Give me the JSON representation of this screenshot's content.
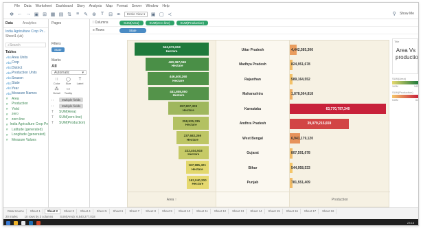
{
  "menu": [
    "File",
    "Data",
    "Worksheet",
    "Dashboard",
    "Story",
    "Analysis",
    "Map",
    "Format",
    "Server",
    "Window",
    "Help"
  ],
  "toolbar": {
    "view_select": "Entire View",
    "show_me": "Show Me"
  },
  "data_pane": {
    "tabs": [
      "Data",
      "Analytics"
    ],
    "sources": [
      "India Agriculture Crop Pr...",
      "Sheet1 (uk)"
    ],
    "search_placeholder": "Search",
    "tables_label": "Tables",
    "dimensions": [
      "Area Units",
      "Crop",
      "District",
      "Production Units",
      "Season",
      "State",
      "Year",
      "Measure Names"
    ],
    "measures": [
      "Area",
      "Production",
      "Yield",
      "zero",
      "zero line",
      "India Agriculture Crop Pro...",
      "Latitude (generated)",
      "Longitude (generated)",
      "Measure Values"
    ]
  },
  "cards": {
    "pages": "Pages",
    "filters": "Filters",
    "filter_pill": "State",
    "marks": "Marks",
    "marks_all": "All",
    "mark_type": "Automatic",
    "mark_buttons": [
      {
        "icon": "∷",
        "label": "Color"
      },
      {
        "icon": "◯",
        "label": "Size"
      },
      {
        "icon": "T",
        "label": "Label"
      },
      {
        "icon": "⁂",
        "label": "Detail"
      },
      {
        "icon": "▭",
        "label": "Tooltip"
      }
    ],
    "mark_fields": [
      "Multiple fields",
      "Multiple fields",
      "SUM(Area)",
      "SUM(zero line)",
      "SUM(Production)"
    ]
  },
  "shelves": {
    "columns_label": "Columns",
    "columns": [
      "SUM(Area)",
      "SUM(zero line)",
      "SUM(Production)"
    ],
    "rows_label": "Rows",
    "rows": [
      "State"
    ]
  },
  "chart_data": {
    "type": "bar",
    "categories": [
      "Uttar Pradesh",
      "Madhya Pradesh",
      "Rajasthan",
      "Maharashtra",
      "Karnataka",
      "Andhra Pradesh",
      "West Bengal",
      "Gujarat",
      "Bihar",
      "Punjab"
    ],
    "series": [
      {
        "name": "Area",
        "unit": "Hectare",
        "values": [
          542672619,
          460367069,
          446400260,
          441808050,
          297807309,
          258925335,
          237682269,
          222404503,
          167985401,
          162040200
        ],
        "labels": [
          "542,672,619",
          "460,367,069",
          "446,400,260",
          "441,808,050",
          "297,807,309",
          "258,925,335",
          "237,682,269",
          "222,404,503",
          "167,985,401",
          "162,040,200"
        ]
      },
      {
        "name": "Production",
        "values": [
          4442585306,
          824951678,
          589164552,
          1878564818,
          63770797340,
          39079215659,
          6941179120,
          807591678,
          544958533,
          781551409
        ],
        "labels": [
          "4,442,585,306",
          "824,951,678",
          "589,164,552",
          "1,878,564,818",
          "63,770,797,340",
          "39,079,215,659",
          "6,941,179,120",
          "807,591,678",
          "544,958,533",
          "781,551,409"
        ]
      }
    ],
    "xlabel_left": "Area ↑",
    "xlabel_right": "Production"
  },
  "legend": {
    "title_small": "Title",
    "title": "Area Vs production",
    "area_label": "SUM(Area)",
    "area_range": [
      "162M",
      "543"
    ],
    "prod_label": "SUM(Production)",
    "prod_range": [
      "545M",
      "64"
    ]
  },
  "sheet_tabs": [
    "Data Source",
    "Sheet 1",
    "Sheet 2",
    "Sheet 3",
    "Sheet 4",
    "Sheet 5",
    "Sheet 6",
    "Sheet 7",
    "Sheet 8",
    "Sheet 9",
    "Sheet 10",
    "Sheet 11",
    "Sheet 12",
    "Sheet 13",
    "Sheet 14",
    "Sheet 15",
    "Sheet 16",
    "Sheet 17",
    "Sheet 18"
  ],
  "active_sheet": "Sheet 2",
  "status": {
    "marks": "20 marks",
    "rows": "10 rows by 3 columns",
    "sum": "SUM(Area): 6,540,277,018"
  },
  "taskbar_time": "23:18",
  "colors": {
    "area_low": "#e6d96f",
    "area_high": "#1f7a3c",
    "prod_low": "#f5c66a",
    "prod_high": "#c8213a"
  }
}
